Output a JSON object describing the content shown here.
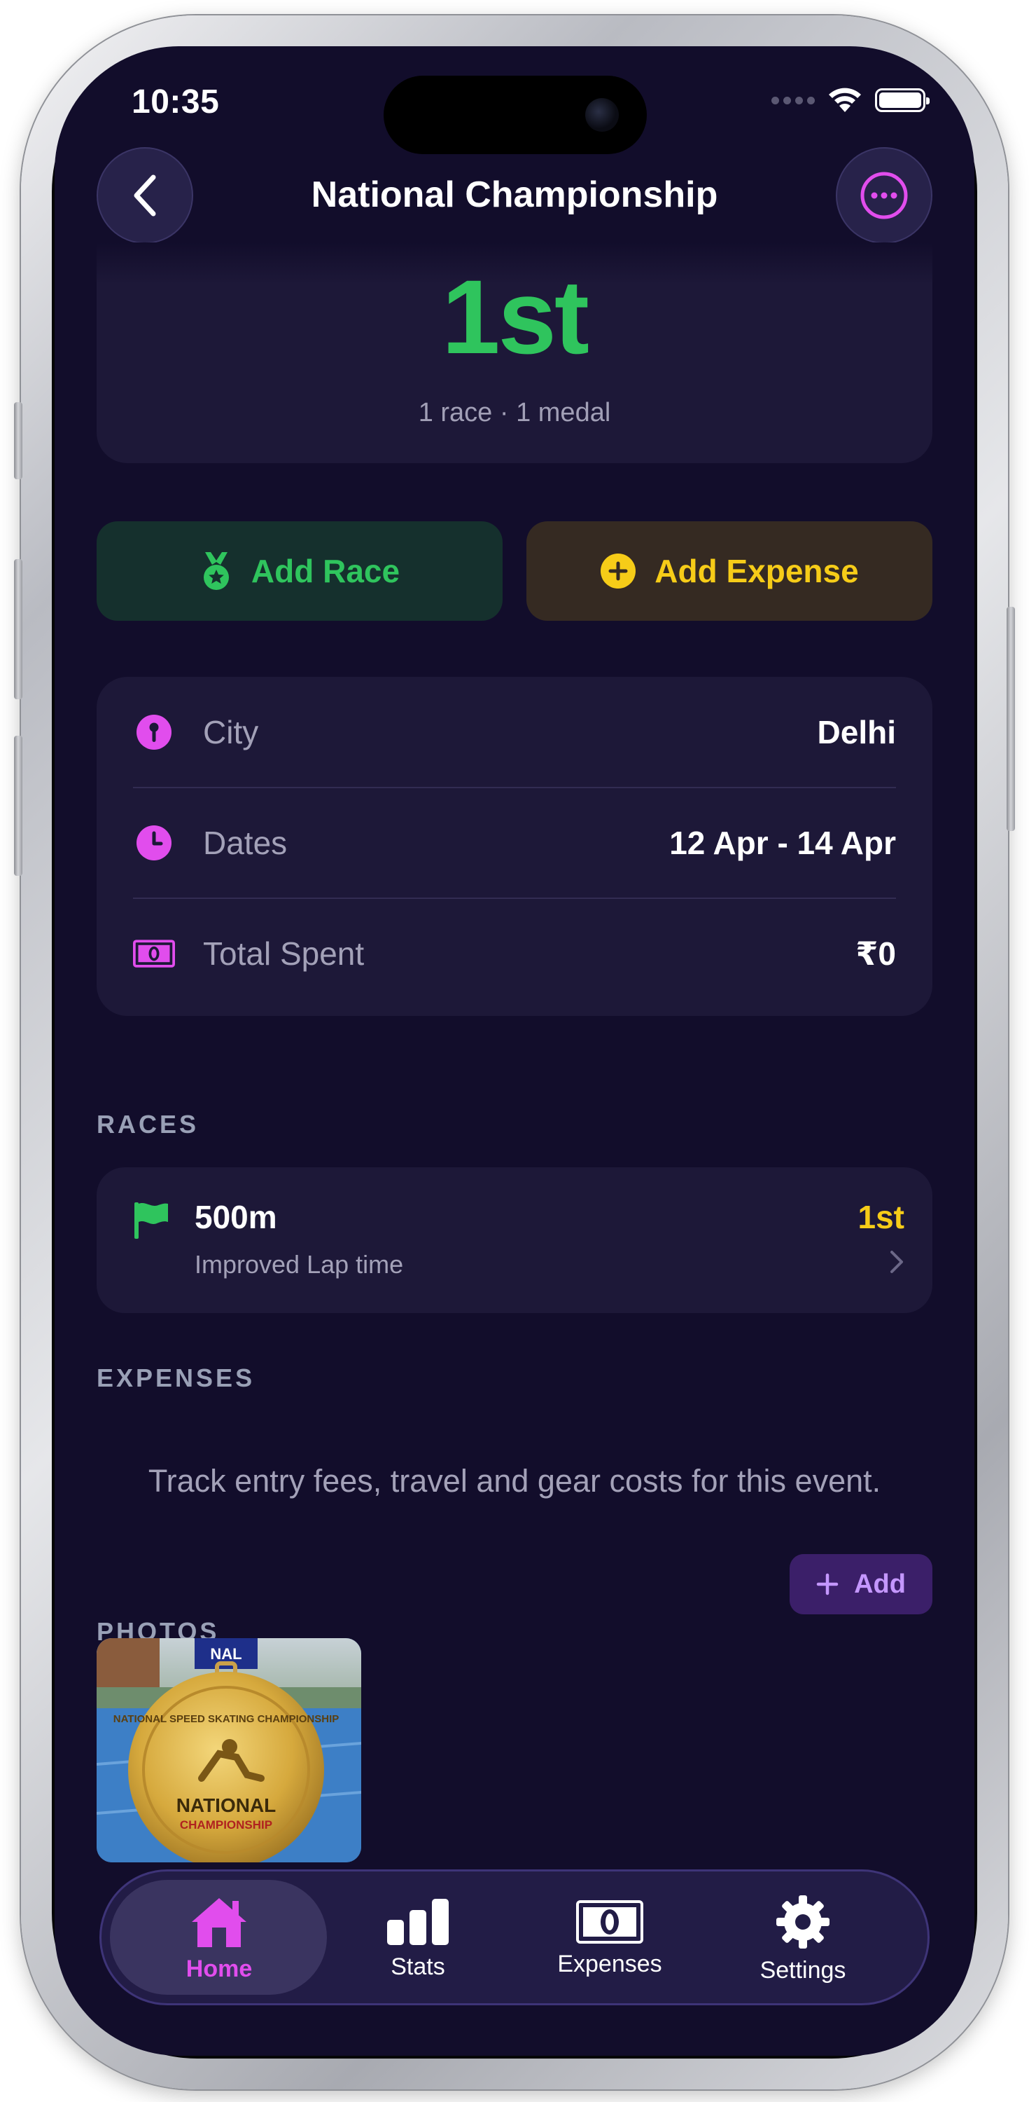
{
  "status_bar": {
    "time": "10:35"
  },
  "header": {
    "title": "National Championship"
  },
  "summary": {
    "position": "1st",
    "subtitle": "1 race · 1 medal"
  },
  "actions": {
    "add_race": "Add Race",
    "add_expense": "Add Expense"
  },
  "info": {
    "city_label": "City",
    "city_value": "Delhi",
    "dates_label": "Dates",
    "dates_value": "12 Apr - 14 Apr",
    "spent_label": "Total Spent",
    "spent_value": "₹0"
  },
  "races": {
    "header": "RACES",
    "items": [
      {
        "name": "500m",
        "note": "Improved Lap time",
        "position": "1st"
      }
    ]
  },
  "expenses": {
    "header": "EXPENSES",
    "empty_text": "Track entry fees, travel and gear costs for this event."
  },
  "photos": {
    "header": "PHOTOS",
    "add_label": "Add",
    "medal_text_top": "NATIONAL SPEED SKATING CHAMPIONSHIP",
    "medal_text_main": "NATIONAL",
    "medal_text_sub": "CHAMPIONSHIP",
    "ribbon_text": "NAL"
  },
  "tabs": [
    {
      "label": "Home",
      "active": true
    },
    {
      "label": "Stats",
      "active": false
    },
    {
      "label": "Expenses",
      "active": false
    },
    {
      "label": "Settings",
      "active": false
    }
  ],
  "colors": {
    "background": "#120d2b",
    "card": "#1d1838",
    "green": "#2fc45d",
    "yellow": "#f6cc18",
    "magenta": "#e14ded",
    "purple_accent": "#c497ff"
  }
}
